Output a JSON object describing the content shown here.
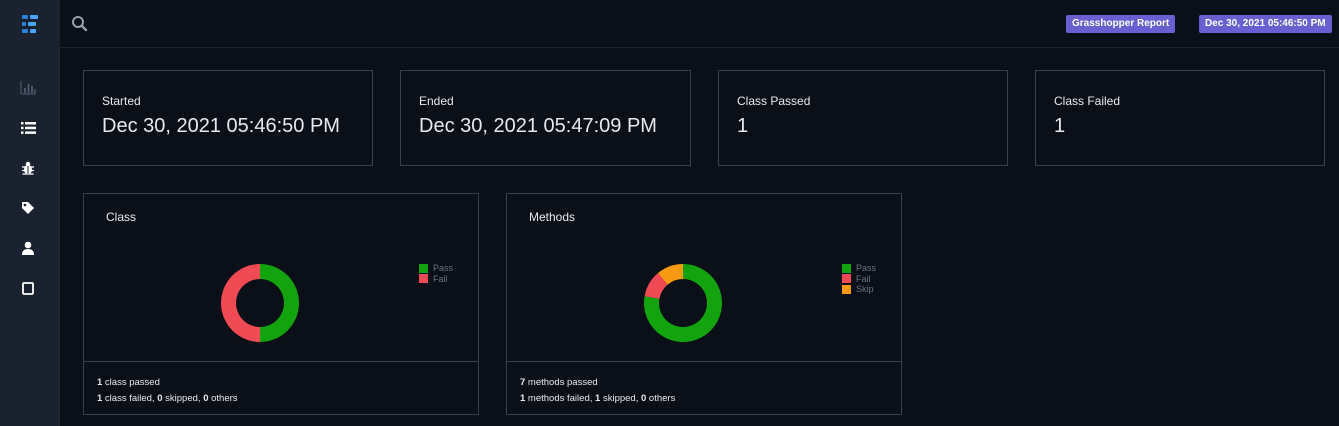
{
  "header": {
    "report_name": "Grasshopper Report",
    "report_date": "Dec 30, 2021 05:46:50 PM"
  },
  "sidebar": {
    "items": [
      {
        "icon": "bar-chart-icon"
      },
      {
        "icon": "list-icon"
      },
      {
        "icon": "bug-icon"
      },
      {
        "icon": "tag-icon"
      },
      {
        "icon": "user-icon"
      },
      {
        "icon": "square-icon"
      }
    ]
  },
  "stats": [
    {
      "label": "Started",
      "value": "Dec 30, 2021 05:46:50 PM"
    },
    {
      "label": "Ended",
      "value": "Dec 30, 2021 05:47:09 PM"
    },
    {
      "label": "Class Passed",
      "value": "1"
    },
    {
      "label": "Class Failed",
      "value": "1"
    }
  ],
  "colors": {
    "pass": "#12a30e",
    "fail": "#f04b55",
    "skip": "#f59a12",
    "badge": "#6a5fd0"
  },
  "chart_data": [
    {
      "type": "pie",
      "title": "Class",
      "categories": [
        "Pass",
        "Fail"
      ],
      "values": [
        1,
        1
      ],
      "legend_position": "right"
    },
    {
      "type": "pie",
      "title": "Methods",
      "categories": [
        "Pass",
        "Fail",
        "Skip"
      ],
      "values": [
        7,
        1,
        1
      ],
      "legend_position": "right"
    }
  ],
  "class_summary": {
    "passed_count": "1",
    "passed_text": " class passed",
    "failed_count": "1",
    "failed_text": " class failed, ",
    "skipped_count": "0",
    "skipped_text": " skipped, ",
    "others_count": "0",
    "others_text": " others"
  },
  "methods_summary": {
    "passed_count": "7",
    "passed_text": " methods passed",
    "failed_count": "1",
    "failed_text": " methods failed, ",
    "skipped_count": "1",
    "skipped_text": " skipped, ",
    "others_count": "0",
    "others_text": " others"
  }
}
